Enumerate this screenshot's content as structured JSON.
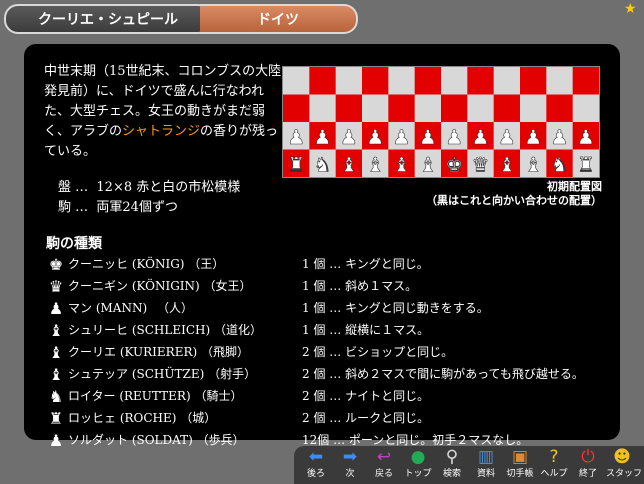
{
  "tabs": {
    "left": "クーリエ・シュピール",
    "right": "ドイツ"
  },
  "intro": {
    "text_before": "中世末期（15世紀末、コロンブスの大陸発見前）に、ドイツで盛んに行なわれた、大型チェス。女王の動きがまだ弱く、アラブの",
    "highlight": "シャトランジ",
    "text_after": "の香りが残っている。"
  },
  "specs": [
    {
      "label": "盤 …",
      "value": "12×8 赤と白の市松模様"
    },
    {
      "label": "駒 …",
      "value": "両軍24個ずつ"
    }
  ],
  "board": {
    "cols": 12,
    "rows": 4,
    "light_color": "#d8d8d8",
    "dark_color": "#e30000",
    "pawn_row": [
      "♟",
      "♟",
      "♟",
      "♟",
      "♟",
      "♟",
      "♟",
      "♟",
      "♟",
      "♟",
      "♟",
      "♟"
    ],
    "back_row": [
      "♜",
      "♞",
      "♝",
      "♝",
      "♝",
      "♝",
      "♚",
      "♛",
      "♝",
      "♝",
      "♞",
      "♜"
    ]
  },
  "caption": {
    "line1": "初期配置図",
    "line2": "（黒はこれと向かい合わせの配置）"
  },
  "section_title": "駒の種類",
  "pieces": [
    {
      "icon": "♚",
      "name": "クーニッヒ (KÖNIG) （王）",
      "desc": "1 個 … キングと同じ。"
    },
    {
      "icon": "♛",
      "name": "クーニギン (KÖNIGIN) （女王）",
      "desc": "1 個 … 斜め１マス。"
    },
    {
      "icon": "♟",
      "name": "マン (MANN) 　（人）",
      "desc": "1 個 … キングと同じ動きをする。"
    },
    {
      "icon": "♝",
      "name": "シュリーヒ (SCHLEICH) （道化）",
      "desc": "1 個 … 縦横に１マス。"
    },
    {
      "icon": "♝",
      "name": "クーリエ (KURIERER) （飛脚）",
      "desc": "2 個 … ビショップと同じ。"
    },
    {
      "icon": "♝",
      "name": "シュテッア (SCHÜTZE) （射手）",
      "desc": "2 個 … 斜め２マスで間に駒があっても飛び越せる。"
    },
    {
      "icon": "♞",
      "name": "ロイター (REUTTER) （騎士）",
      "desc": "2 個 … ナイトと同じ。"
    },
    {
      "icon": "♜",
      "name": "ロッヒェ (ROCHE) （城）",
      "desc": "2 個 … ルークと同じ。"
    },
    {
      "icon": "♟",
      "name": "ソルダット (SOLDAT) （歩兵）",
      "desc": "12個 … ポーンと同じ。初手２マスなし。"
    }
  ],
  "toolbar": [
    {
      "icon": "back-arrow-icon",
      "glyph": "⬅",
      "color": "#3c8cff",
      "label": "後ろ"
    },
    {
      "icon": "forward-arrow-icon",
      "glyph": "➡",
      "color": "#3c8cff",
      "label": "次"
    },
    {
      "icon": "return-icon",
      "glyph": "↩",
      "color": "#c040c0",
      "label": "戻る"
    },
    {
      "icon": "globe-icon",
      "glyph": "●",
      "color": "#22aa55",
      "label": "トップ"
    },
    {
      "icon": "magnifier-icon",
      "glyph": "⚲",
      "color": "#dddddd",
      "label": "検索"
    },
    {
      "icon": "books-icon",
      "glyph": "▥",
      "color": "#4a90d0",
      "label": "資料"
    },
    {
      "icon": "stamp-icon",
      "glyph": "▣",
      "color": "#e08a30",
      "label": "切手帳"
    },
    {
      "icon": "help-icon",
      "glyph": "?",
      "color": "#f0c020",
      "label": "ヘルプ"
    },
    {
      "icon": "power-icon",
      "glyph": "⏻",
      "color": "#ff3333",
      "label": "終了"
    },
    {
      "icon": "staff-icon",
      "glyph": "☻",
      "color": "#f0c020",
      "label": "スタッフ"
    }
  ]
}
